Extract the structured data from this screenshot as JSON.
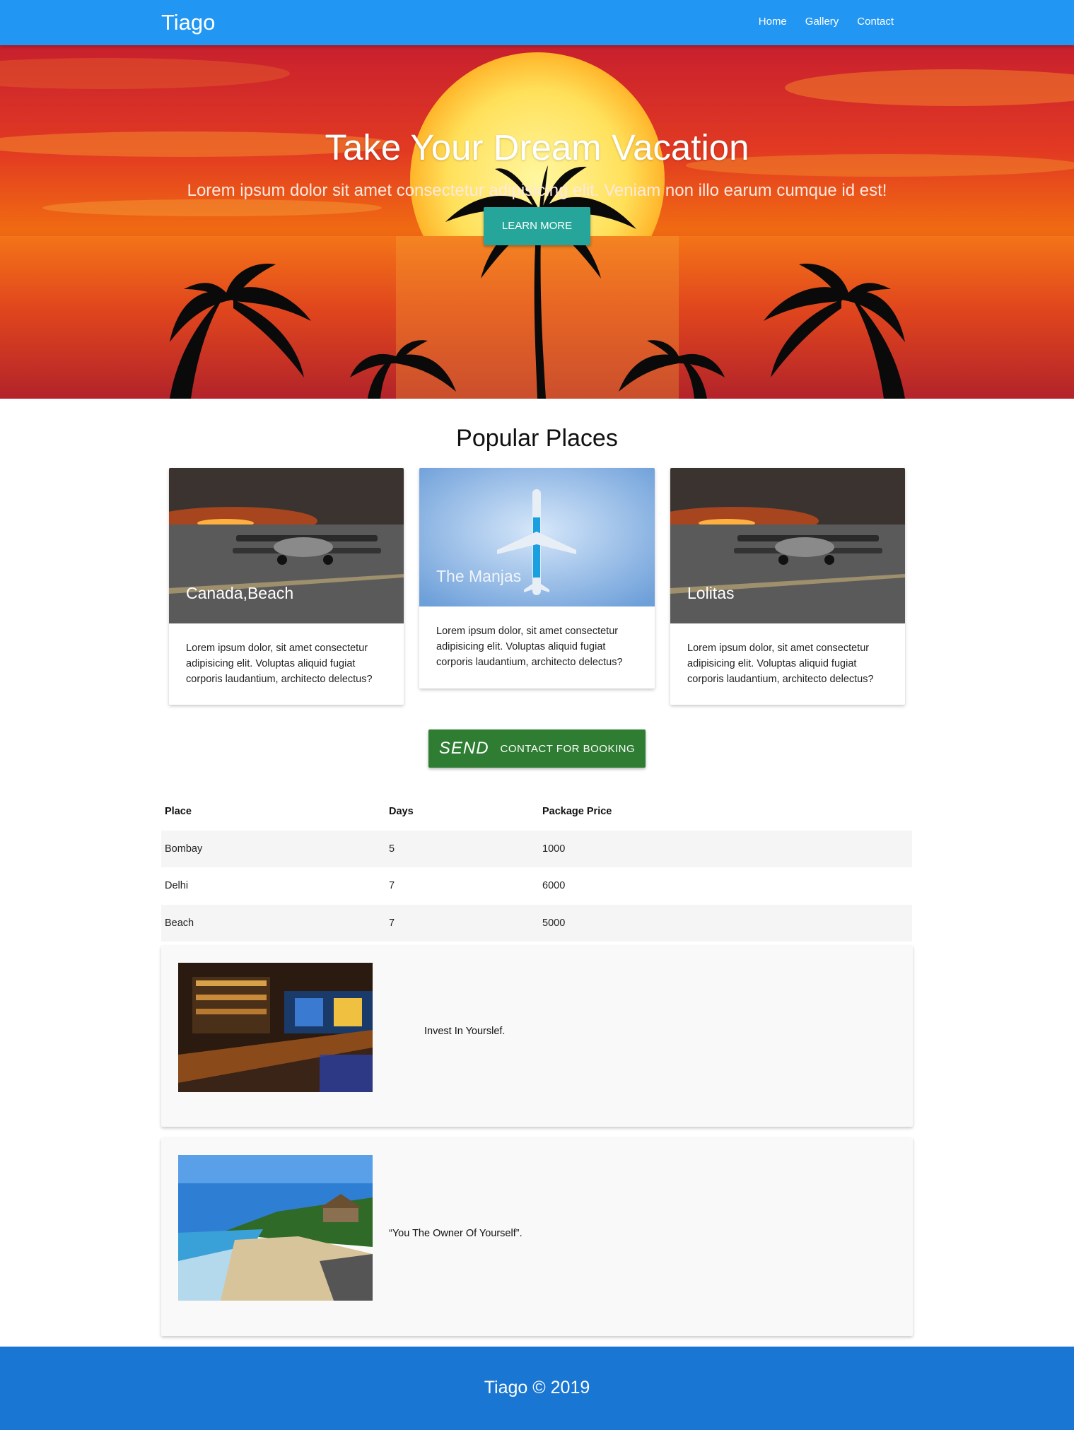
{
  "navbar": {
    "brand": "Tiago",
    "links": [
      "Home",
      "Gallery",
      "Contact"
    ]
  },
  "hero": {
    "title": "Take Your Dream Vacation",
    "subtitle": "Lorem ipsum dolor sit amet consectetur adipisicing elit. Veniam non illo earum cumque id est!",
    "button": "LEARN MORE"
  },
  "popular": {
    "title": "Popular Places",
    "cards": [
      {
        "title": "Canada,Beach",
        "text": "Lorem ipsum dolor, sit amet consectetur adipisicing elit. Voluptas aliquid fugiat corporis laudantium, architecto delectus?"
      },
      {
        "title": "The Manjas",
        "text": "Lorem ipsum dolor, sit amet consectetur adipisicing elit. Voluptas aliquid fugiat corporis laudantium, architecto delectus?"
      },
      {
        "title": "Lolitas",
        "text": "Lorem ipsum dolor, sit amet consectetur adipisicing elit. Voluptas aliquid fugiat corporis laudantium, architecto delectus?"
      }
    ]
  },
  "booking": {
    "icon": "SEND",
    "label": "CONTACT FOR BOOKING"
  },
  "table": {
    "headers": [
      "Place",
      "Days",
      "Package Price"
    ],
    "rows": [
      [
        "Bombay",
        "5",
        "1000"
      ],
      [
        "Delhi",
        "7",
        "6000"
      ],
      [
        "Beach",
        "7",
        "5000"
      ]
    ]
  },
  "panels": [
    {
      "text": "Invest In Yourslef."
    },
    {
      "text": "“You The Owner Of Yourself”."
    }
  ],
  "footer": {
    "text": "Tiago © 2019"
  },
  "colors": {
    "navbar": "#2196f3",
    "learn_more": "#26a69a",
    "send_button": "#2e7d32",
    "footer": "#1976d2"
  }
}
